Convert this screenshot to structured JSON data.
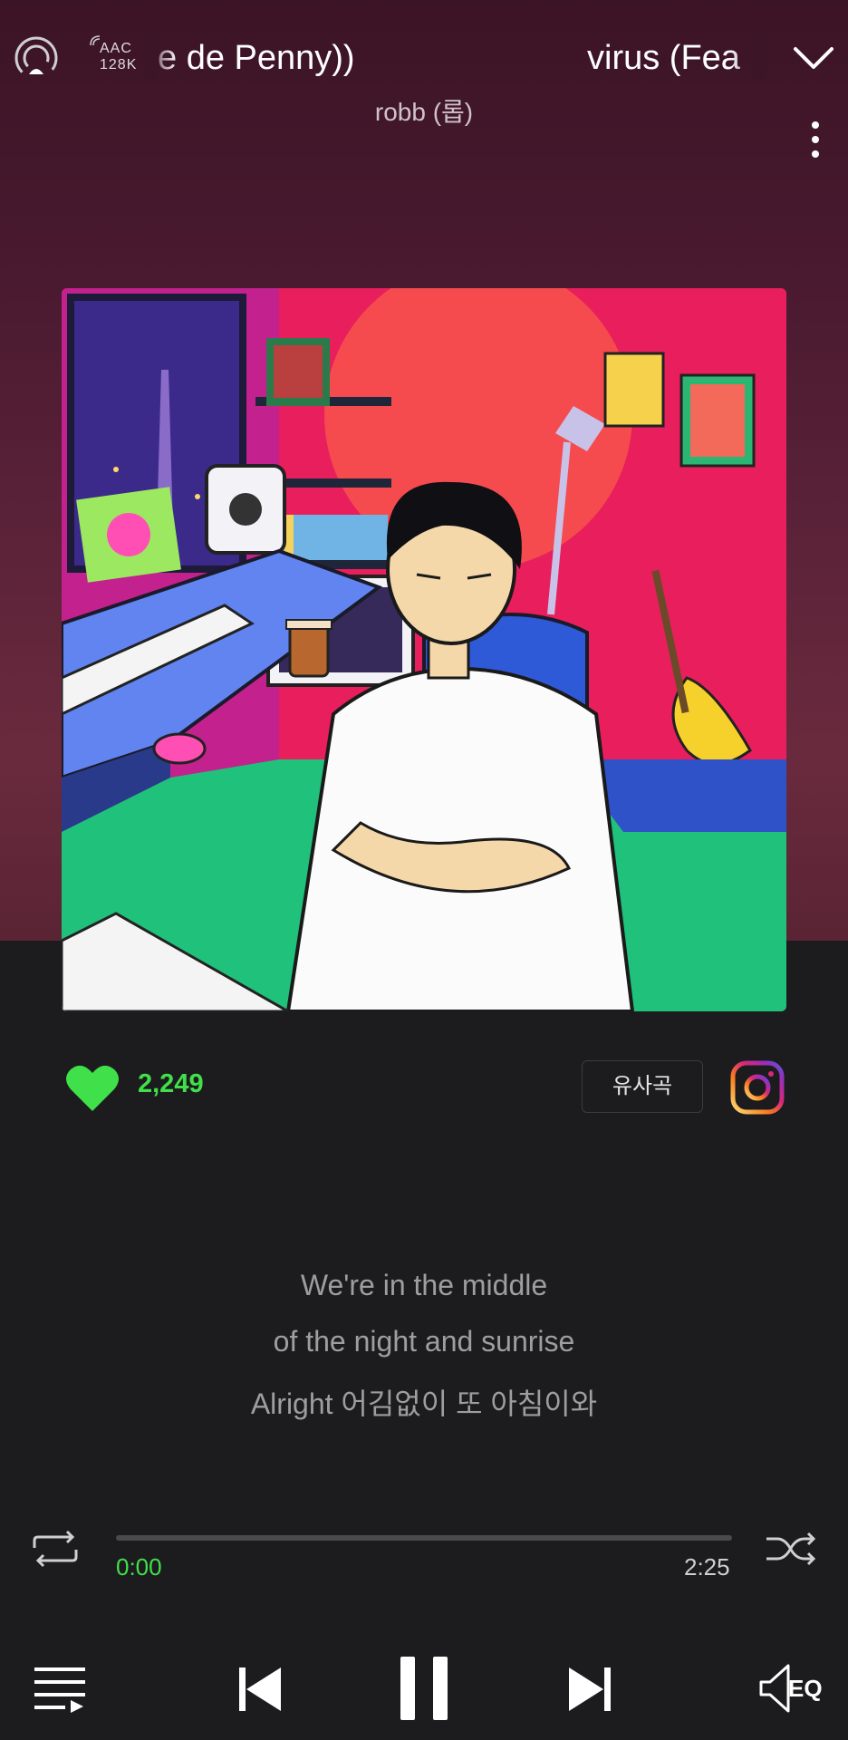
{
  "header": {
    "title_segment_1": "e de Penny))",
    "title_segment_2": "virus (Fea",
    "artist": "robb (롭)",
    "badge_line_1": "AAC",
    "badge_line_2": "128K"
  },
  "album_art": {
    "icon": "album-cover-illustration"
  },
  "actions": {
    "like_count": "2,249",
    "similar_songs_label": "유사곡",
    "heart_color": "#3fe04a",
    "icons": [
      "heart-icon",
      "instagram-icon"
    ]
  },
  "lyrics": {
    "lines": [
      "We're in the middle",
      "of the night and sunrise",
      "Alright 어김없이 또 아침이와"
    ]
  },
  "progress": {
    "current_time": "0:00",
    "total_time": "2:25",
    "fraction": 0.0,
    "accent_color": "#3fe04a"
  },
  "controls": {
    "eq_label": "EQ",
    "icons": [
      "repeat-icon",
      "shuffle-icon",
      "playlist-icon",
      "previous-icon",
      "pause-icon",
      "next-icon",
      "eq-icon"
    ]
  }
}
